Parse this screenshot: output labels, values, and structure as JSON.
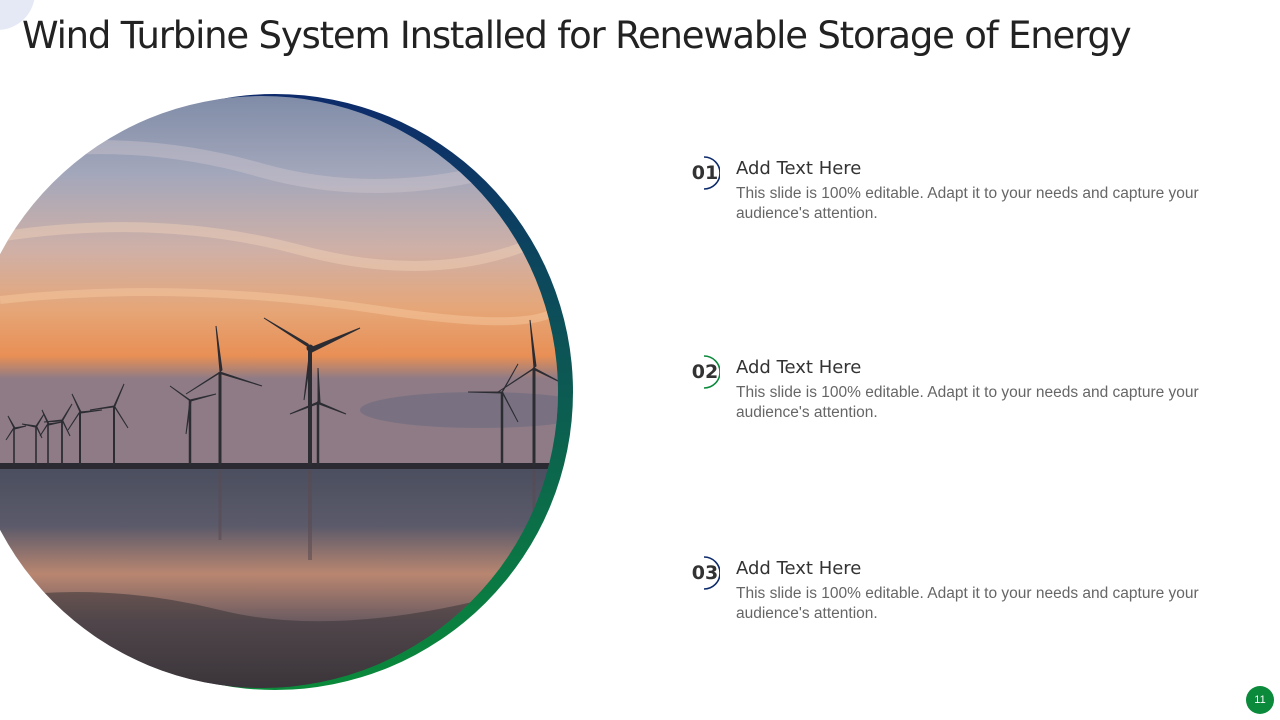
{
  "slide": {
    "title": "Wind Turbine System Installed for Renewable Storage of Energy",
    "page_number": "11"
  },
  "colors": {
    "ring_top": "#0d2b6b",
    "ring_bottom": "#0a8a3a",
    "page_badge": "#0a8a3a",
    "corner_accent": "#e4e9f5"
  },
  "hero_image": {
    "icon": "wind-turbines-sunset-photo"
  },
  "points": [
    {
      "number": "01",
      "heading": "Add Text Here",
      "body": "This slide is 100% editable. Adapt it to your needs and capture your audience's attention."
    },
    {
      "number": "02",
      "heading": "Add Text Here",
      "body": "This slide is 100% editable. Adapt it to your needs and capture your audience's attention."
    },
    {
      "number": "03",
      "heading": "Add Text Here",
      "body": "This slide is 100% editable. Adapt it to your needs and capture your audience's attention."
    }
  ]
}
